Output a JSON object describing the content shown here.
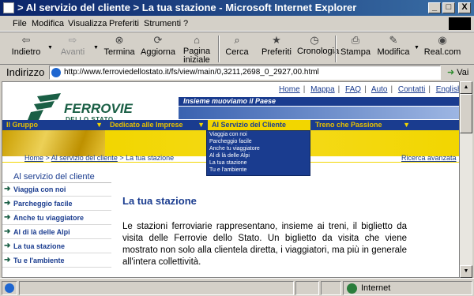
{
  "window": {
    "title": "> Al servizio del cliente > La tua stazione - Microsoft Internet Explorer",
    "buttons": [
      "_",
      "□",
      "X"
    ]
  },
  "menu": [
    "File",
    "Modifica",
    "Visualizza",
    "Preferiti",
    "Strumenti",
    "?"
  ],
  "toolbar": {
    "indietro": "Indietro",
    "avanti": "Avanti",
    "termina": "Termina",
    "aggiorna": "Aggiorna",
    "pagina_iniziale": "Pagina iniziale",
    "cerca": "Cerca",
    "preferiti": "Preferiti",
    "cronologia": "Cronologia",
    "stampa": "Stampa",
    "modifica": "Modifica",
    "realcom": "Real.com"
  },
  "address": {
    "label": "Indirizzo",
    "url": "http://www.ferroviedellostato.it/fs/view/main/0,3211,2698_0_2927,00.html",
    "go": "Vai"
  },
  "page": {
    "top_links": [
      "Home",
      "Mappa",
      "FAQ",
      "Auto",
      "Contatti",
      "English"
    ],
    "logo": {
      "name": "FERROVIE",
      "sub": "DELLO STATO"
    },
    "slogan": "Insieme muoviamo il Paese",
    "nav": [
      "Il Gruppo",
      "Dedicato alle Imprese",
      "Al Servizio del Cliente",
      "Treno che Passione"
    ],
    "dropdown": [
      "Viaggia con noi",
      "Parcheggio facile",
      "Anche tu viaggiatore",
      "Al di là delle Alpi",
      "La tua stazione",
      "Tu e l'ambiente"
    ],
    "breadcrumb": {
      "home": "Home",
      "sep": " > ",
      "section": "Al servizio del cliente",
      "current": "La tua stazione"
    },
    "search_link": "Ricerca avanzata",
    "sidebar": {
      "title": "Al servizio del cliente",
      "items": [
        "Viaggia con noi",
        "Parcheggio facile",
        "Anche tu viaggiatore",
        "Al di là delle Alpi",
        "La tua stazione",
        "Tu e l'ambiente"
      ]
    },
    "main": {
      "title": "La tua stazione",
      "text": "Le stazioni ferroviarie rappresentano, insieme ai treni, il biglietto da visita delle Ferrovie dello Stato. Un biglietto da visita che viene mostrato non solo alla clientela diretta, i viaggiatori, ma più in generale all'intera collettività."
    }
  },
  "status": {
    "zone": "Internet"
  },
  "colors": {
    "fs_blue": "#1a3c8f",
    "fs_yellow": "#f2d600",
    "fs_green": "#1a5f45",
    "titlebar": "#0a246a"
  }
}
